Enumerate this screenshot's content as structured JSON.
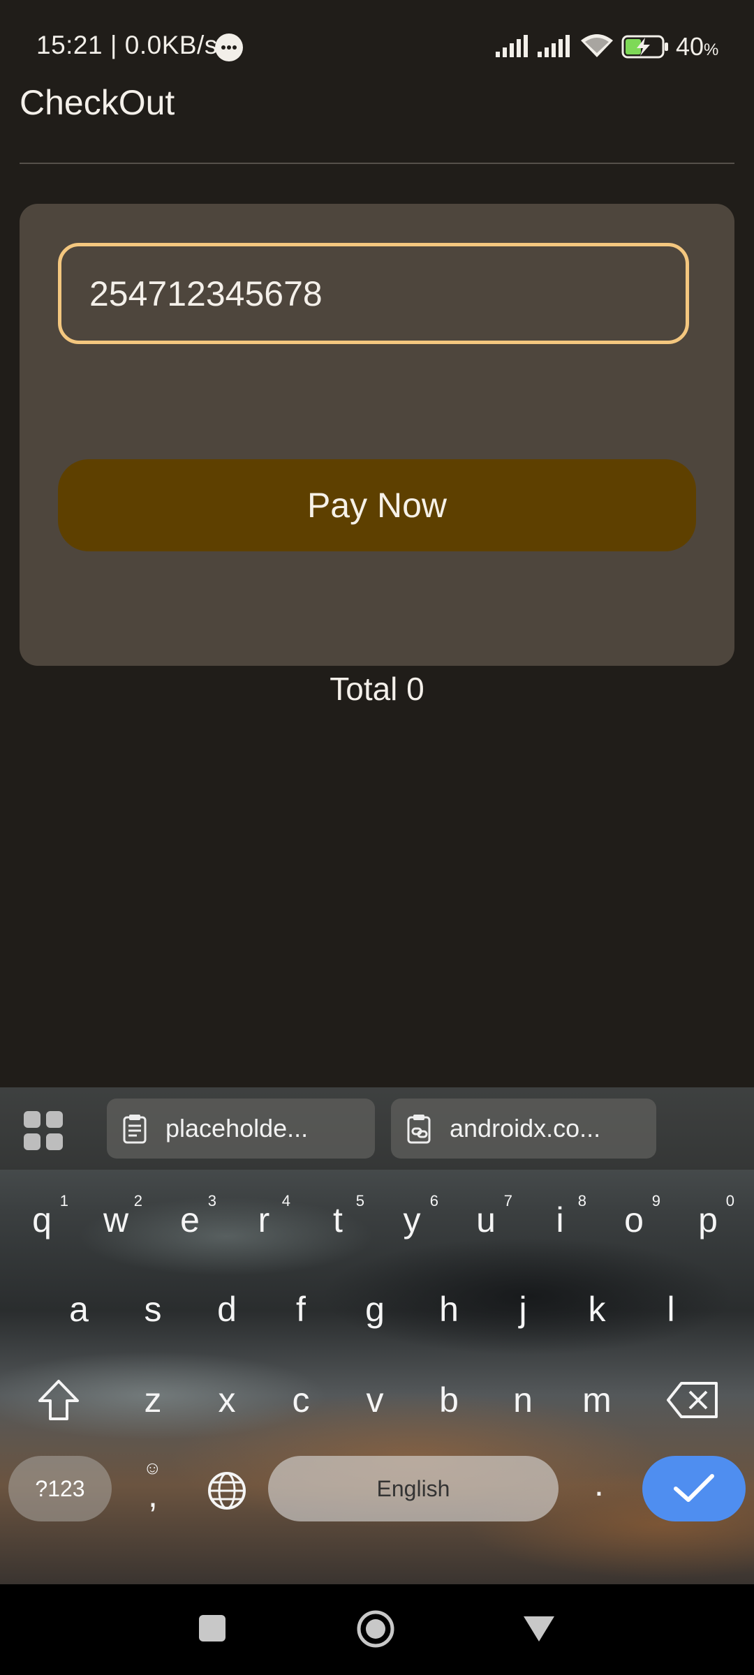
{
  "status_bar": {
    "time_speed": "15:21 | 0.0KB/s",
    "battery": "40",
    "battery_unit": "%"
  },
  "app_bar": {
    "title": "CheckOut"
  },
  "form": {
    "phone_value": "254712345678",
    "pay_button": "Pay Now",
    "total": "Total 0"
  },
  "keyboard": {
    "clipboard_items": [
      "placeholde...",
      "androidx.co..."
    ],
    "row1": [
      {
        "k": "q",
        "n": "1"
      },
      {
        "k": "w",
        "n": "2"
      },
      {
        "k": "e",
        "n": "3"
      },
      {
        "k": "r",
        "n": "4"
      },
      {
        "k": "t",
        "n": "5"
      },
      {
        "k": "y",
        "n": "6"
      },
      {
        "k": "u",
        "n": "7"
      },
      {
        "k": "i",
        "n": "8"
      },
      {
        "k": "o",
        "n": "9"
      },
      {
        "k": "p",
        "n": "0"
      }
    ],
    "row2": [
      "a",
      "s",
      "d",
      "f",
      "g",
      "h",
      "j",
      "k",
      "l"
    ],
    "row3": [
      "z",
      "x",
      "c",
      "v",
      "b",
      "n",
      "m"
    ],
    "symbols_key": "?123",
    "comma_key": ",",
    "period_key": ".",
    "space_label": "English"
  },
  "colors": {
    "background": "#201d19",
    "card": "#4e463d",
    "input_border": "#f4c77f",
    "button": "#5e4000",
    "enter_key": "#4f8ef0"
  }
}
